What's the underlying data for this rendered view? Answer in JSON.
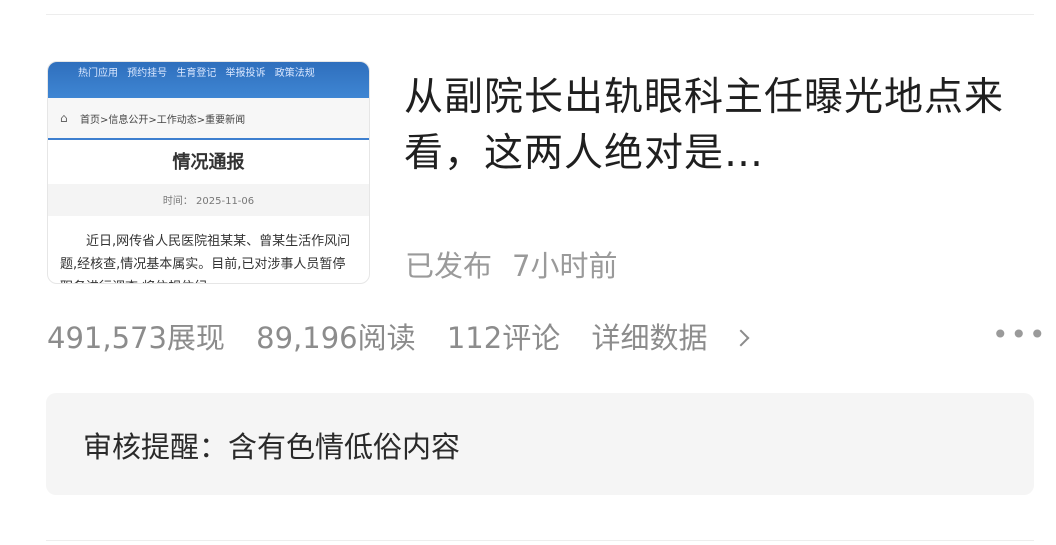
{
  "thumbnail": {
    "nav_items": "热门应用  预约挂号  生育登记  举报投诉  政策法规",
    "breadcrumb": "首页>信息公开>工作动态>重要新闻",
    "title": "情况通报",
    "time": "时间： 2025-11-06",
    "body": "近日,网传省人民医院祖某某、曾某生活作风问题,经核查,情况基本属实。目前,已对涉事人员暂停职务进行调查,将依规依纪"
  },
  "article": {
    "headline": "从副院长出轨眼科主任曝光地点来看，这两人绝对是…",
    "status": "已发布",
    "time_ago": "7小时前"
  },
  "stats": {
    "impressions": "491,573展现",
    "reads": "89,196阅读",
    "comments": "112评论",
    "detail_label": "详细数据"
  },
  "more_label": "•••",
  "notice": {
    "text": "审核提醒：含有色情低俗内容"
  },
  "icons": {
    "home": "home-icon",
    "chevron": "chevron-right-icon",
    "more": "more-dots-icon"
  }
}
